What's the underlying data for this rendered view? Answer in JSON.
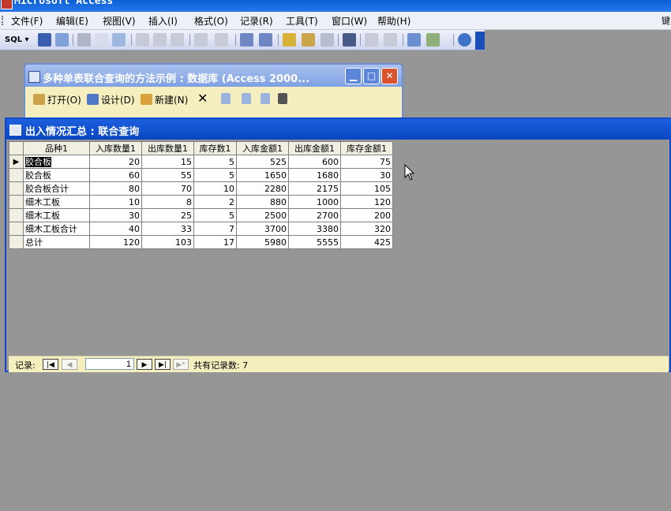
{
  "app": {
    "title": "Microsoft Access",
    "edge_char": "键"
  },
  "menu": [
    {
      "label": "文件(F)"
    },
    {
      "label": "编辑(E)"
    },
    {
      "label": "视图(V)"
    },
    {
      "label": "插入(I)"
    },
    {
      "label": "格式(O)"
    },
    {
      "label": "记录(R)"
    },
    {
      "label": "工具(T)"
    },
    {
      "label": "窗口(W)"
    },
    {
      "label": "帮助(H)"
    }
  ],
  "toolbar": {
    "view_dropdown": "SQL ▾"
  },
  "db_window": {
    "title": "多种单表联合查询的方法示例 : 数据库 (Access 2000...",
    "open_label": "打开(O)",
    "design_label": "设计(D)",
    "new_label": "新建(N)"
  },
  "query_window": {
    "title": "出入情况汇总 : 联合查询",
    "columns": [
      "品种1",
      "入库数量1",
      "出库数量1",
      "库存数1",
      "入库金额1",
      "出库金额1",
      "库存金额1"
    ],
    "rows": [
      [
        "胶合板",
        "20",
        "15",
        "5",
        "525",
        "600",
        "75"
      ],
      [
        "胶合板",
        "60",
        "55",
        "5",
        "1650",
        "1680",
        "30"
      ],
      [
        "胶合板合计",
        "80",
        "70",
        "10",
        "2280",
        "2175",
        "105"
      ],
      [
        "细木工板",
        "10",
        "8",
        "2",
        "880",
        "1000",
        "120"
      ],
      [
        "细木工板",
        "30",
        "25",
        "5",
        "2500",
        "2700",
        "200"
      ],
      [
        "细木工板合计",
        "40",
        "33",
        "7",
        "3700",
        "3380",
        "320"
      ],
      [
        "总计",
        "120",
        "103",
        "17",
        "5980",
        "5555",
        "425"
      ]
    ],
    "current_row_marker": "▶"
  },
  "navigator": {
    "label": "记录:",
    "current_record": "1",
    "total_label": "共有记录数: 7",
    "first": "|◀",
    "prev": "◀",
    "next": "▶",
    "last": "▶|",
    "new": "▶*"
  },
  "colors": {
    "active_title": "#0a45c0",
    "datasheet_bg": "#969696",
    "nav_bg": "#f5efc0"
  }
}
